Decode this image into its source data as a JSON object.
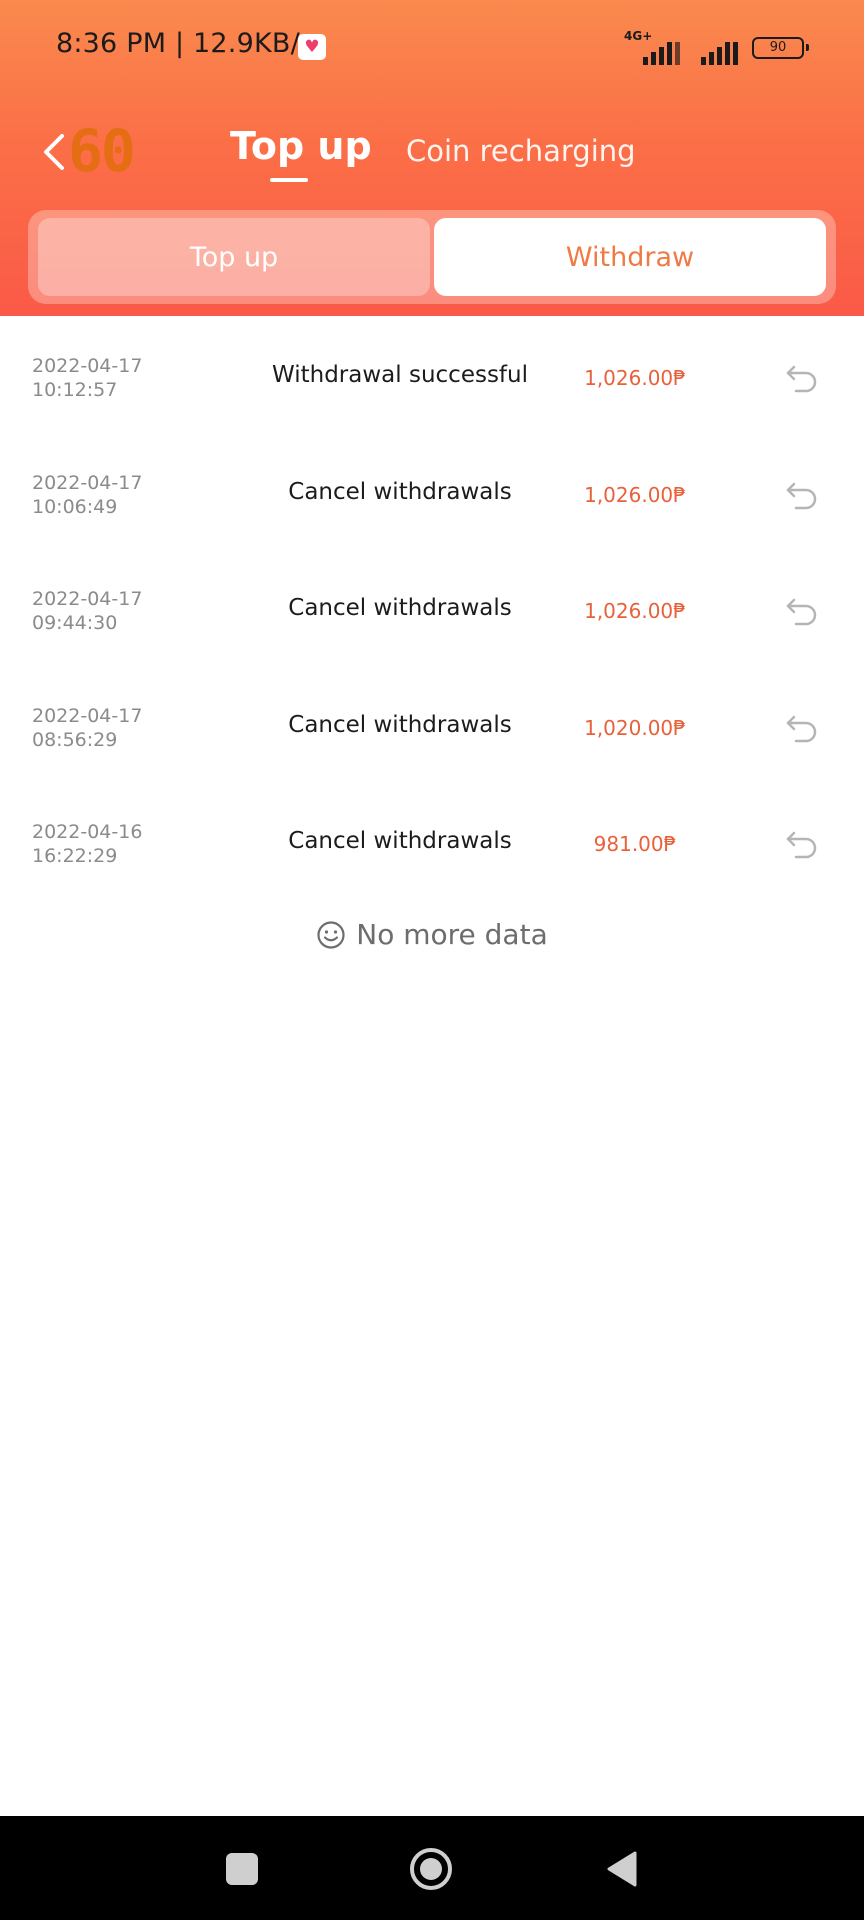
{
  "status_bar": {
    "time": "8:36 PM | 12.9KB/s",
    "network_type": "4G+",
    "battery": "90",
    "notification_icon": "heart-app-icon"
  },
  "nav": {
    "back_icon": "chevron-left-icon",
    "back_counter": "60",
    "tabs": [
      {
        "label": "Top up",
        "active": true
      },
      {
        "label": "Coin recharging",
        "active": false
      }
    ]
  },
  "segment": {
    "options": [
      {
        "label": "Top up",
        "selected": false
      },
      {
        "label": "Withdraw",
        "selected": true
      }
    ]
  },
  "records": [
    {
      "date": "2022-04-17",
      "time": "10:12:57",
      "status": "Withdrawal successful",
      "amount": "1,026.00₱",
      "action_icon": "undo-icon"
    },
    {
      "date": "2022-04-17",
      "time": "10:06:49",
      "status": "Cancel withdrawals",
      "amount": "1,026.00₱",
      "action_icon": "undo-icon"
    },
    {
      "date": "2022-04-17",
      "time": "09:44:30",
      "status": "Cancel withdrawals",
      "amount": "1,026.00₱",
      "action_icon": "undo-icon"
    },
    {
      "date": "2022-04-17",
      "time": "08:56:29",
      "status": "Cancel withdrawals",
      "amount": "1,020.00₱",
      "action_icon": "undo-icon"
    },
    {
      "date": "2022-04-16",
      "time": "16:22:29",
      "status": "Cancel withdrawals",
      "amount": "981.00₱",
      "action_icon": "undo-icon"
    }
  ],
  "footer": {
    "no_more_icon": "smiley-icon",
    "no_more_text": "No more data"
  },
  "colors": {
    "header_top": "#fa8a4e",
    "header_bottom": "#fa5a47",
    "accent": "#f07a45",
    "amount": "#e9613a",
    "back_counter": "#e56d14"
  },
  "system_nav": {
    "recents_icon": "square-icon",
    "home_icon": "home-circle-icon",
    "back_icon": "triangle-back-icon"
  }
}
